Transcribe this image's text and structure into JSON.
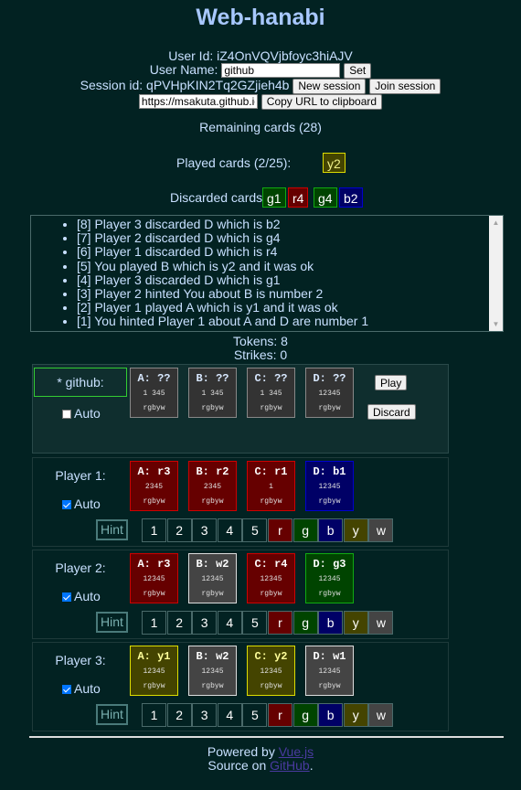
{
  "app": {
    "title": "Web-hanabi"
  },
  "user": {
    "id_label": "User Id:",
    "id_value": "iZ4OnVQVjbfoyc3hiAJV",
    "name_label": "User Name:",
    "name_value": "github",
    "set_label": "Set"
  },
  "session": {
    "label": "Session id:",
    "value": "qPVHpKIN2Tq2GZjieh4b",
    "new_label": "New session",
    "join_label": "Join session",
    "url_value": "https://msakuta.github.io/w",
    "copy_label": "Copy URL to clipboard"
  },
  "game": {
    "remaining": "Remaining cards (28)",
    "played_label": "Played cards (2/25):",
    "played": [
      {
        "text": "y2",
        "color": "yellow"
      }
    ],
    "discarded_label": "Discarded cards:",
    "discarded": [
      {
        "text": "g1",
        "color": "green"
      },
      {
        "text": "r4",
        "color": "red"
      },
      {
        "text": "g4",
        "color": "green"
      },
      {
        "text": "b2",
        "color": "blue"
      }
    ],
    "log": [
      "[8] Player 3 discarded D which is b2",
      "[7] Player 2 discarded D which is g4",
      "[6] Player 1 discarded D which is r4",
      "[5] You played B which is y2 and it was ok",
      "[4] Player 3 discarded D which is g1",
      "[3] Player 2 hinted You about B is number 2",
      "[2] Player 1 played A which is y1 and it was ok",
      "[1] You hinted Player 1 about A and D are number 1"
    ],
    "tokens": "Tokens: 8",
    "strikes": "Strikes: 0"
  },
  "me": {
    "name": "* github:",
    "auto_label": "Auto",
    "auto_checked": false,
    "play_label": "Play",
    "discard_label": "Discard",
    "cards": [
      {
        "title": "A: ??",
        "nums": "1 345",
        "colors": "rgbyw"
      },
      {
        "title": "B: ??",
        "nums": "1 345",
        "colors": "rgbyw"
      },
      {
        "title": "C: ??",
        "nums": "1 345",
        "colors": "rgbyw"
      },
      {
        "title": "D: ??",
        "nums": "12345",
        "colors": "rgbyw"
      }
    ]
  },
  "players": [
    {
      "name": "Player 1:",
      "auto_label": "Auto",
      "auto_checked": true,
      "hint_label": "Hint",
      "cards": [
        {
          "title": "A: r3",
          "nums": "2345",
          "colors": "rgbyw",
          "color": "red"
        },
        {
          "title": "B: r2",
          "nums": "2345",
          "colors": "rgbyw",
          "color": "red"
        },
        {
          "title": "C: r1",
          "nums": "1",
          "colors": "rgbyw",
          "color": "red"
        },
        {
          "title": "D: b1",
          "nums": "12345",
          "colors": "rgbyw",
          "color": "blue"
        }
      ]
    },
    {
      "name": "Player 2:",
      "auto_label": "Auto",
      "auto_checked": true,
      "hint_label": "Hint",
      "cards": [
        {
          "title": "A: r3",
          "nums": "12345",
          "colors": "rgbyw",
          "color": "red"
        },
        {
          "title": "B: w2",
          "nums": "12345",
          "colors": "rgbyw",
          "color": "white"
        },
        {
          "title": "C: r4",
          "nums": "12345",
          "colors": "rgbyw",
          "color": "red"
        },
        {
          "title": "D: g3",
          "nums": "12345",
          "colors": "rgbyw",
          "color": "green"
        }
      ]
    },
    {
      "name": "Player 3:",
      "auto_label": "Auto",
      "auto_checked": true,
      "hint_label": "Hint",
      "cards": [
        {
          "title": "A: y1",
          "nums": "12345",
          "colors": "rgbyw",
          "color": "yellow"
        },
        {
          "title": "B: w2",
          "nums": "12345",
          "colors": "rgbyw",
          "color": "white"
        },
        {
          "title": "C: y2",
          "nums": "12345",
          "colors": "rgbyw",
          "color": "yellow"
        },
        {
          "title": "D: w1",
          "nums": "12345",
          "colors": "rgbyw",
          "color": "white"
        }
      ]
    }
  ],
  "hint_keys": [
    "1",
    "2",
    "3",
    "4",
    "5",
    "r",
    "g",
    "b",
    "y",
    "w"
  ],
  "palette": {
    "red": {
      "bg": "#660000",
      "border": "#cc0000"
    },
    "green": {
      "bg": "#004400",
      "border": "#11aa11"
    },
    "blue": {
      "bg": "#000066",
      "border": "#0000cc"
    },
    "yellow": {
      "bg": "#444400",
      "border": "#dddd00"
    },
    "white": {
      "bg": "#444444",
      "border": "#dddddd"
    },
    "unknown": {
      "bg": "#333333",
      "border": "#888888"
    }
  },
  "footer": {
    "powered_prefix": "Powered by ",
    "powered_link": "Vue.js",
    "source_prefix": "Source on ",
    "source_link": "GitHub",
    "source_suffix": "."
  }
}
